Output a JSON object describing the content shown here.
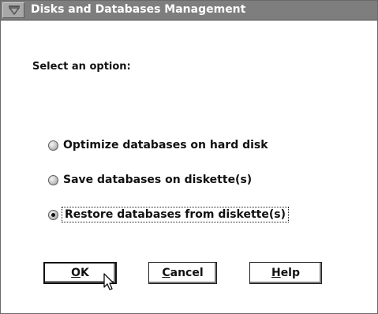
{
  "window": {
    "title": "Disks and Databases Management"
  },
  "dialog": {
    "prompt": "Select an option:",
    "options": [
      {
        "label": "Optimize databases on hard disk",
        "selected": false
      },
      {
        "label": "Save databases on diskette(s)",
        "selected": false
      },
      {
        "label": "Restore databases from diskette(s)",
        "selected": true
      }
    ]
  },
  "buttons": {
    "ok": {
      "mnemonic": "O",
      "rest": "K"
    },
    "cancel": {
      "mnemonic": "C",
      "rest": "ancel"
    },
    "help": {
      "mnemonic": "H",
      "rest": "elp"
    }
  },
  "icons": {
    "system_menu": "system-menu-icon",
    "radio": "radio-button-icon",
    "pointer": "mouse-pointer-icon"
  },
  "colors": {
    "titlebar": "#7e7e7e",
    "title_text": "#ffffff",
    "background": "#ffffff"
  }
}
